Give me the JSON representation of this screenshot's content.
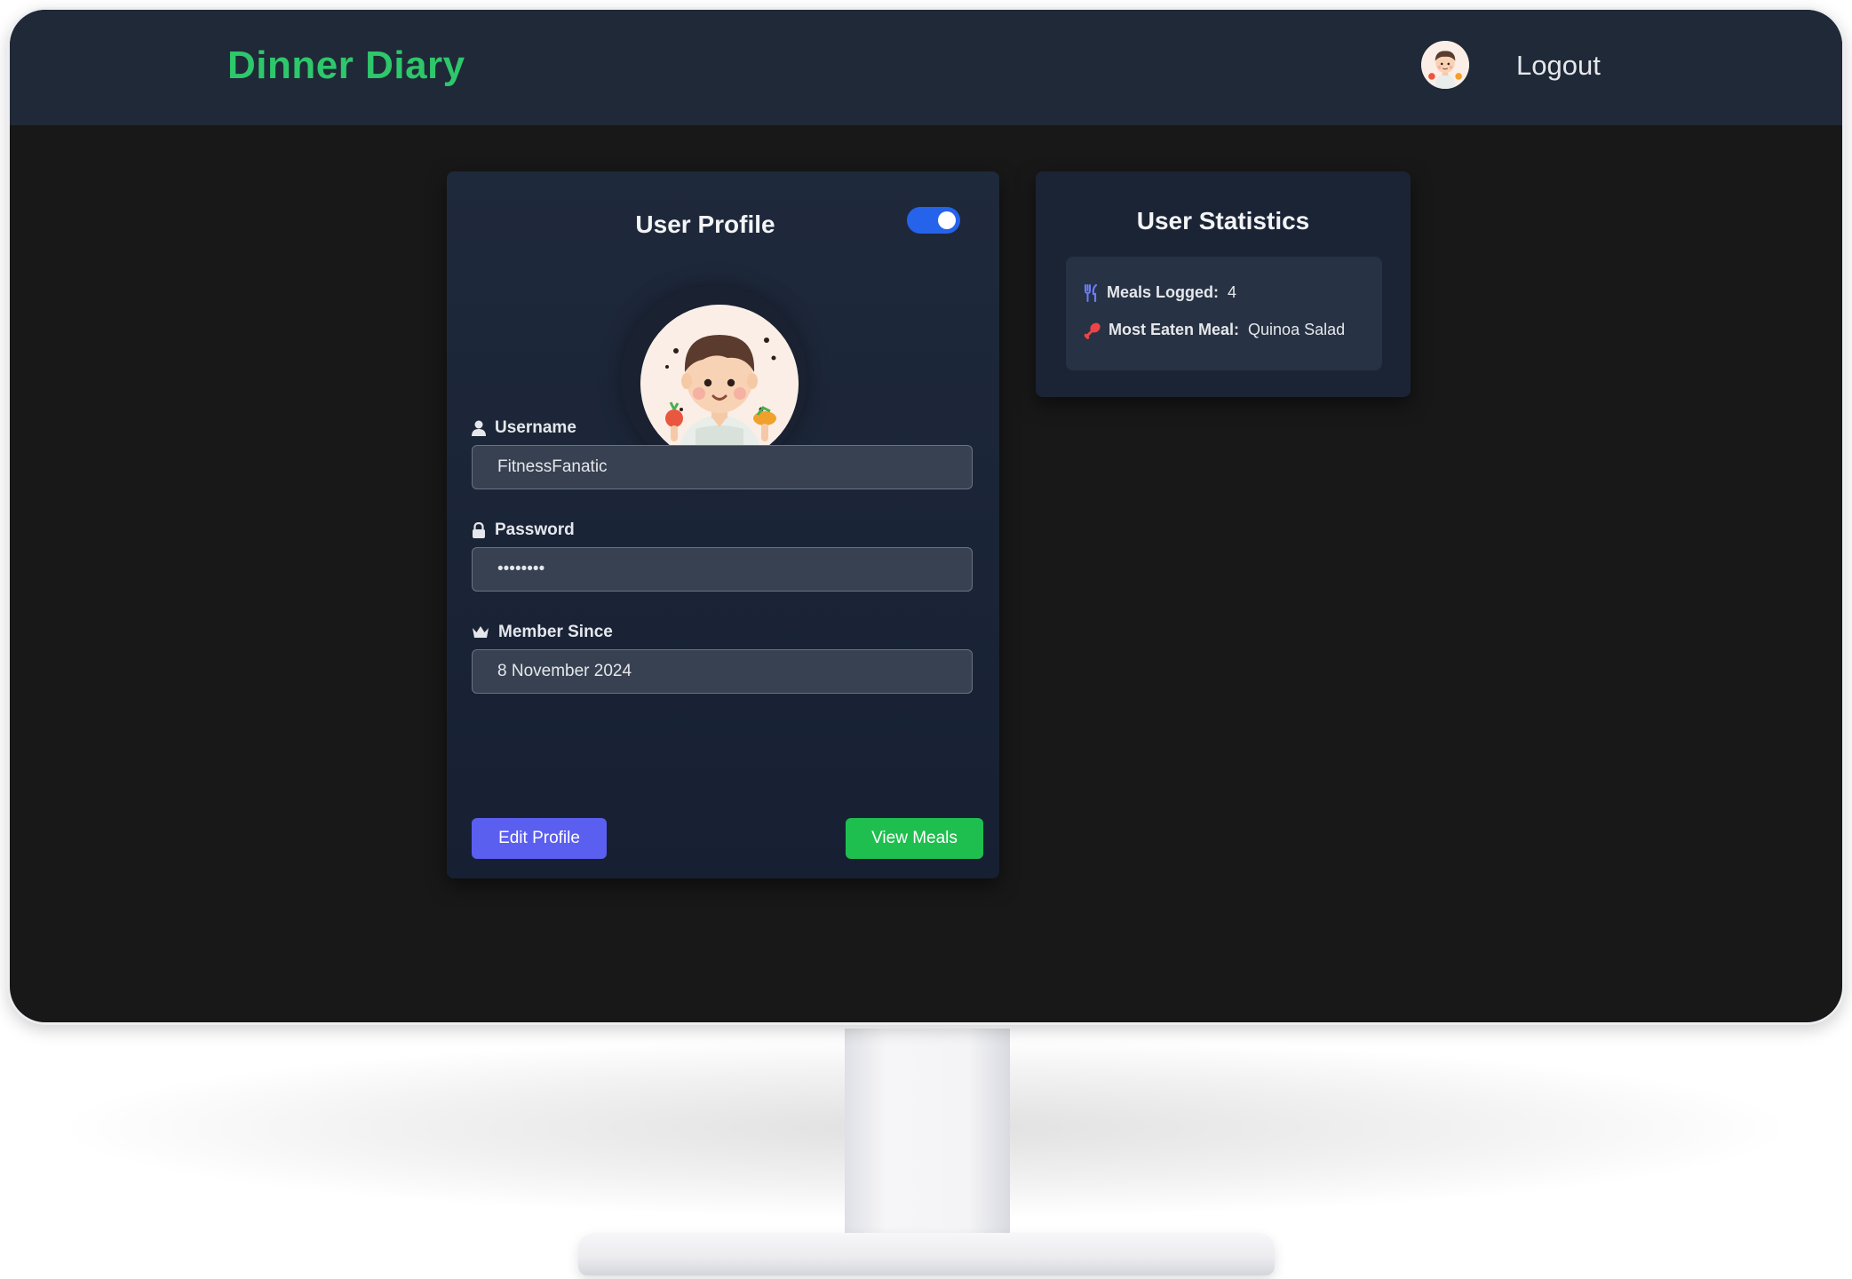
{
  "header": {
    "brand": "Dinner Diary",
    "logout_label": "Logout",
    "avatar_icon": "chef-avatar-icon"
  },
  "profile": {
    "title": "User Profile",
    "toggle_on": true,
    "toggle_color": "#2563eb",
    "fields": {
      "username": {
        "label": "Username",
        "value": "FitnessFanatic",
        "icon": "user-icon"
      },
      "password": {
        "label": "Password",
        "value": "••••••••",
        "icon": "lock-icon"
      },
      "member_since": {
        "label": "Member Since",
        "value": "8 November 2024",
        "icon": "crown-icon"
      }
    },
    "edit_button": "Edit Profile",
    "view_button": "View Meals"
  },
  "stats": {
    "title": "User Statistics",
    "meals_logged_label": "Meals Logged:",
    "meals_logged_value": "4",
    "meals_logged_icon": "utensils-icon",
    "most_eaten_label": "Most Eaten Meal:",
    "most_eaten_value": "Quinoa Salad",
    "most_eaten_icon": "drumstick-icon"
  },
  "colors": {
    "brand_green": "#2ec76b",
    "edit_button": "#5b5ff0",
    "view_button": "#1fbf4f",
    "header_bg": "#1f2937",
    "page_bg": "#181818"
  }
}
